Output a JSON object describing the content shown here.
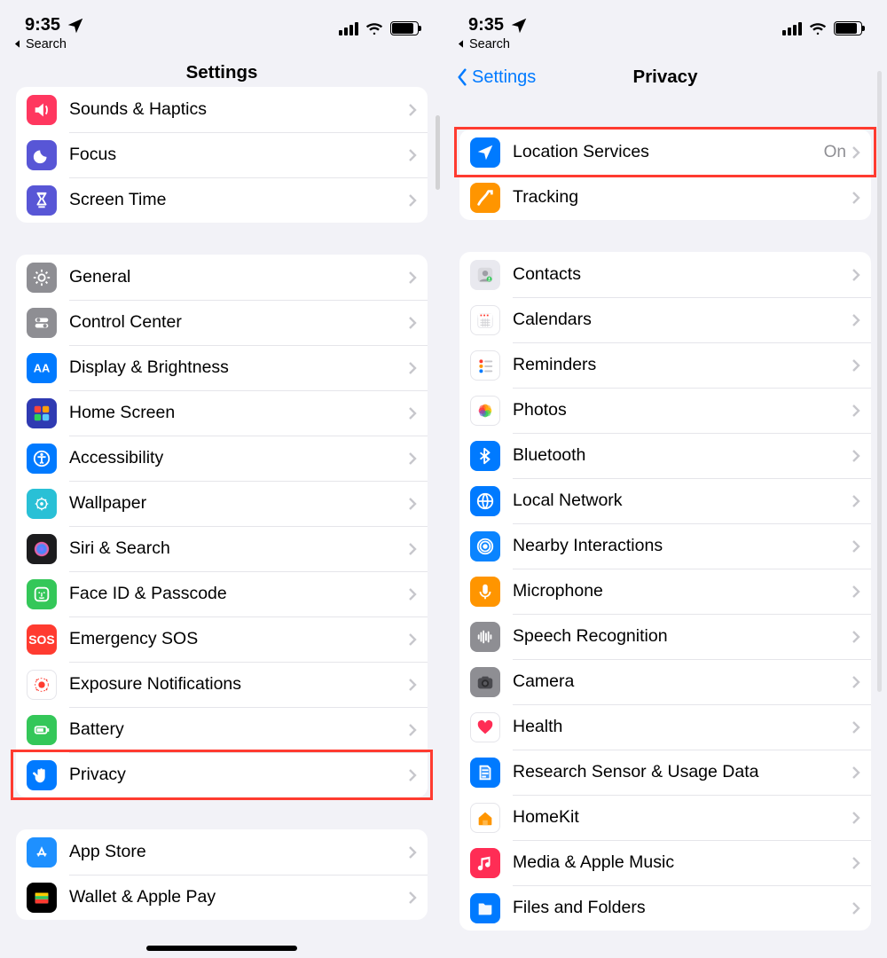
{
  "status": {
    "time": "9:35",
    "back": "Search"
  },
  "left": {
    "title": "Settings",
    "groupA": [
      {
        "label": "Sounds & Haptics",
        "icon": "sounds",
        "bg": "#ff375f"
      },
      {
        "label": "Focus",
        "icon": "focus",
        "bg": "#5856d6"
      },
      {
        "label": "Screen Time",
        "icon": "screentime",
        "bg": "#5856d6"
      }
    ],
    "groupB": [
      {
        "label": "General",
        "icon": "general",
        "bg": "#8e8e93"
      },
      {
        "label": "Control Center",
        "icon": "control",
        "bg": "#8e8e93"
      },
      {
        "label": "Display & Brightness",
        "icon": "display",
        "bg": "#007aff"
      },
      {
        "label": "Home Screen",
        "icon": "homescreen",
        "bg": "#2f3ab2"
      },
      {
        "label": "Accessibility",
        "icon": "access",
        "bg": "#007aff"
      },
      {
        "label": "Wallpaper",
        "icon": "wallpaper",
        "bg": "#29c0d6"
      },
      {
        "label": "Siri & Search",
        "icon": "siri",
        "bg": "#1c1c1e"
      },
      {
        "label": "Face ID & Passcode",
        "icon": "faceid",
        "bg": "#34c759"
      },
      {
        "label": "Emergency SOS",
        "icon": "sos",
        "bg": "#ff3b30"
      },
      {
        "label": "Exposure Notifications",
        "icon": "exposure",
        "bg": "#ffffff"
      },
      {
        "label": "Battery",
        "icon": "battery",
        "bg": "#34c759"
      },
      {
        "label": "Privacy",
        "icon": "privacy",
        "bg": "#007aff",
        "highlight": true
      }
    ],
    "groupC": [
      {
        "label": "App Store",
        "icon": "appstore",
        "bg": "#1e90ff"
      },
      {
        "label": "Wallet & Apple Pay",
        "icon": "wallet",
        "bg": "#000000"
      }
    ]
  },
  "right": {
    "back": "Settings",
    "title": "Privacy",
    "groupA": [
      {
        "label": "Location Services",
        "icon": "location",
        "bg": "#007aff",
        "detail": "On",
        "highlight": true
      },
      {
        "label": "Tracking",
        "icon": "tracking",
        "bg": "#ff9500"
      }
    ],
    "groupB": [
      {
        "label": "Contacts",
        "icon": "contacts",
        "bg": "#e9e9ef"
      },
      {
        "label": "Calendars",
        "icon": "calendar",
        "bg": "#ffffff"
      },
      {
        "label": "Reminders",
        "icon": "reminders",
        "bg": "#ffffff"
      },
      {
        "label": "Photos",
        "icon": "photos",
        "bg": "#ffffff"
      },
      {
        "label": "Bluetooth",
        "icon": "bluetooth",
        "bg": "#007aff"
      },
      {
        "label": "Local Network",
        "icon": "localnet",
        "bg": "#007aff"
      },
      {
        "label": "Nearby Interactions",
        "icon": "nearby",
        "bg": "#0a84ff"
      },
      {
        "label": "Microphone",
        "icon": "mic",
        "bg": "#ff9500"
      },
      {
        "label": "Speech Recognition",
        "icon": "speech",
        "bg": "#8e8e93"
      },
      {
        "label": "Camera",
        "icon": "camera",
        "bg": "#8e8e93"
      },
      {
        "label": "Health",
        "icon": "health",
        "bg": "#ffffff"
      },
      {
        "label": "Research Sensor & Usage Data",
        "icon": "research",
        "bg": "#007aff"
      },
      {
        "label": "HomeKit",
        "icon": "homekit",
        "bg": "#ffffff"
      },
      {
        "label": "Media & Apple Music",
        "icon": "music",
        "bg": "#ff2d55"
      },
      {
        "label": "Files and Folders",
        "icon": "files",
        "bg": "#007aff"
      }
    ]
  }
}
